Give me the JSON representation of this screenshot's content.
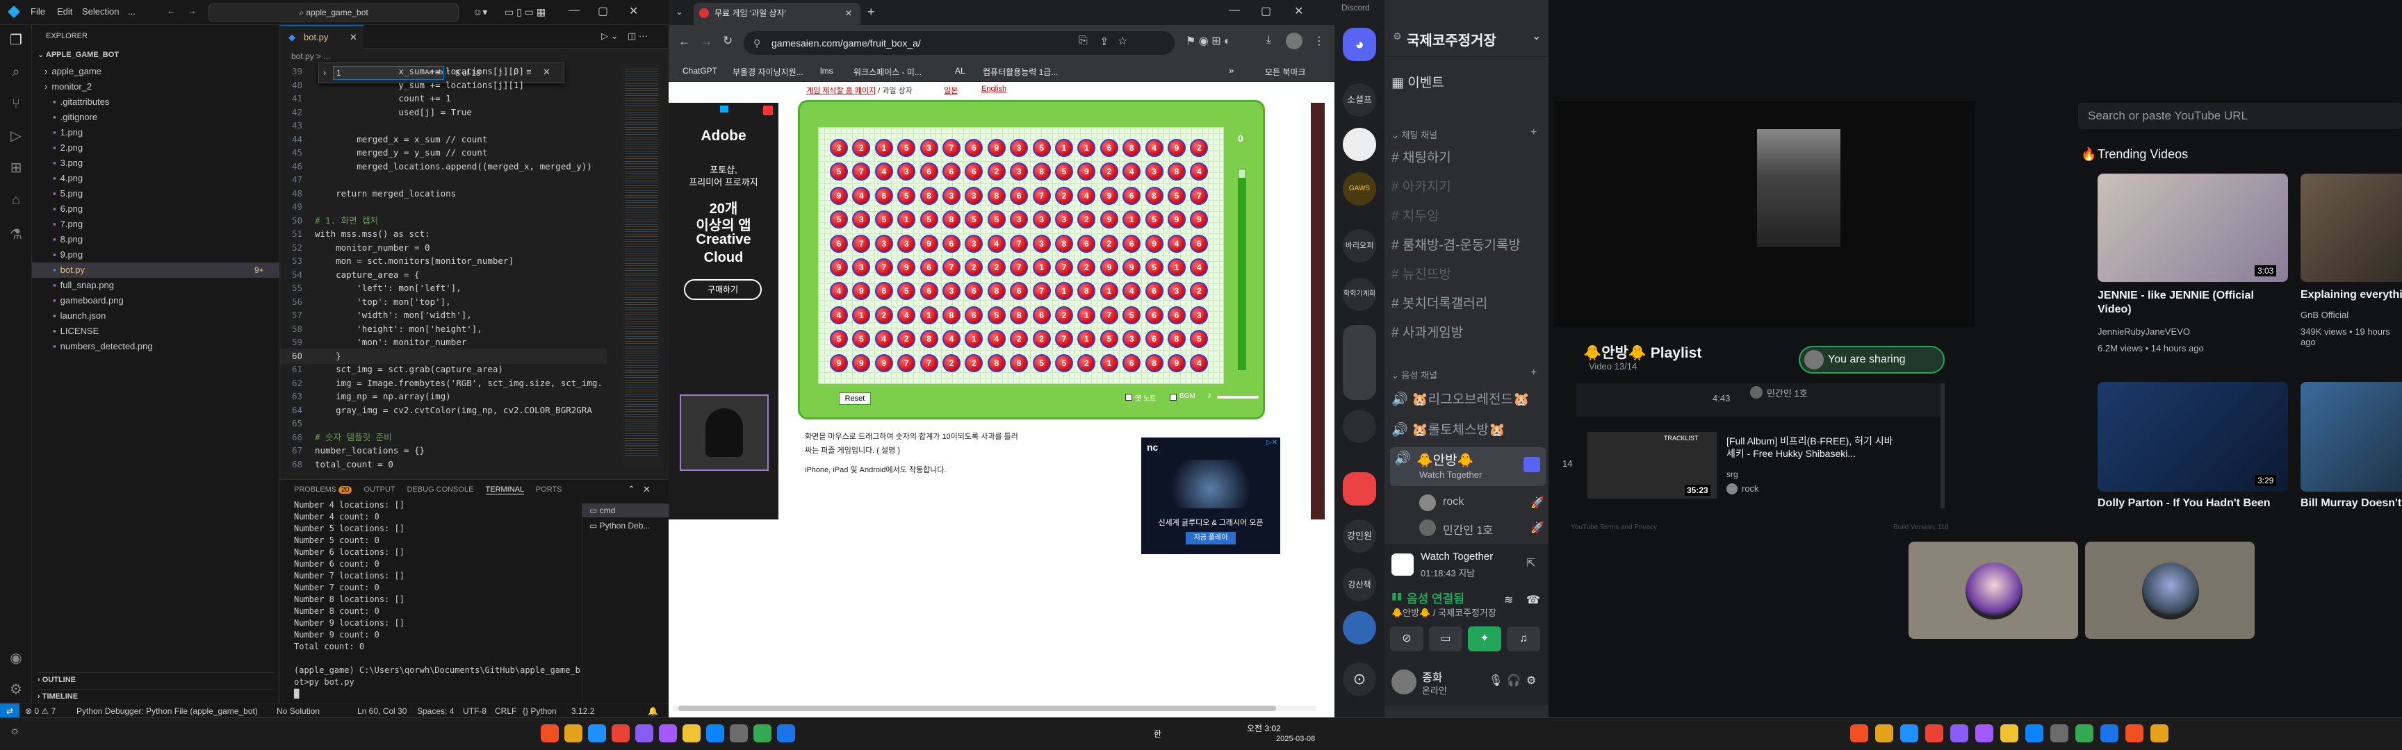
{
  "vscode": {
    "menu": [
      "File",
      "Edit",
      "Selection",
      "..."
    ],
    "search": "apple_game_bot",
    "explorer_title": "EXPLORER",
    "project": "APPLE_GAME_BOT",
    "files": [
      "apple_game",
      "monitor_2",
      ".gitattributes",
      ".gitignore",
      "1.png",
      "2.png",
      "3.png",
      "4.png",
      "5.png",
      "6.png",
      "7.png",
      "8.png",
      "9.png",
      "bot.py",
      "full_snap.png",
      "gameboard.png",
      "launch.json",
      "LICENSE",
      "numbers_detected.png"
    ],
    "active_file": "bot.py",
    "active_badge": "9+",
    "outline": "OUTLINE",
    "timeline": "TIMELINE",
    "tab": "bot.py",
    "breadcrumb": "bot.py > ...",
    "find_value": "1",
    "find_count": "8 of 18",
    "code_lines": [
      {
        "n": "39",
        "t": "                x_sum += locations[j][0]"
      },
      {
        "n": "40",
        "t": "                y_sum += locations[j][1]"
      },
      {
        "n": "41",
        "t": "                count += 1"
      },
      {
        "n": "42",
        "t": "                used[j] = True"
      },
      {
        "n": "43",
        "t": ""
      },
      {
        "n": "44",
        "t": "        merged_x = x_sum // count"
      },
      {
        "n": "45",
        "t": "        merged_y = y_sum // count"
      },
      {
        "n": "46",
        "t": "        merged_locations.append((merged_x, merged_y))"
      },
      {
        "n": "47",
        "t": ""
      },
      {
        "n": "48",
        "t": "    return merged_locations"
      },
      {
        "n": "49",
        "t": ""
      },
      {
        "n": "50",
        "t": "# 1. 화면 캡처"
      },
      {
        "n": "51",
        "t": "with mss.mss() as sct:"
      },
      {
        "n": "52",
        "t": "    monitor_number = 0"
      },
      {
        "n": "53",
        "t": "    mon = sct.monitors[monitor_number]"
      },
      {
        "n": "54",
        "t": "    capture_area = {"
      },
      {
        "n": "55",
        "t": "        'left': mon['left'],"
      },
      {
        "n": "56",
        "t": "        'top': mon['top'],"
      },
      {
        "n": "57",
        "t": "        'width': mon['width'],"
      },
      {
        "n": "58",
        "t": "        'height': mon['height'],"
      },
      {
        "n": "59",
        "t": "        'mon': monitor_number"
      },
      {
        "n": "60",
        "t": "    }"
      },
      {
        "n": "61",
        "t": "    sct_img = sct.grab(capture_area)"
      },
      {
        "n": "62",
        "t": "    img = Image.frombytes('RGB', sct_img.size, sct_img."
      },
      {
        "n": "63",
        "t": "    img_np = np.array(img)"
      },
      {
        "n": "64",
        "t": "    gray_img = cv2.cvtColor(img_np, cv2.COLOR_BGR2GRA"
      },
      {
        "n": "65",
        "t": ""
      },
      {
        "n": "66",
        "t": "# 숫자 템플릿 준비"
      },
      {
        "n": "67",
        "t": "number_locations = {}"
      },
      {
        "n": "68",
        "t": "total_count = 0"
      }
    ],
    "panel_tabs": [
      "PROBLEMS",
      "OUTPUT",
      "DEBUG CONSOLE",
      "TERMINAL",
      "PORTS"
    ],
    "problems_badge": "20",
    "terminal_lines": [
      "Number 4 locations: []",
      "Number 4 count: 0",
      "Number 5 locations: []",
      "Number 5 count: 0",
      "Number 6 locations: []",
      "Number 6 count: 0",
      "Number 7 locations: []",
      "Number 7 count: 0",
      "Number 8 locations: []",
      "Number 8 count: 0",
      "Number 9 locations: []",
      "Number 9 count: 0",
      "Total count: 0",
      "",
      "(apple_game) C:\\Users\\qorwh\\Documents\\GitHub\\apple_game_b",
      "ot>py bot.py",
      "█"
    ],
    "terminals": [
      "cmd",
      "Python Deb..."
    ],
    "status": {
      "left": "⊗ 0 ⚠ 7",
      "debugger": "Python Debugger: Python File (apple_game_bot)",
      "solution": "No Solution",
      "pos": "Ln 60, Col 30",
      "spaces": "Spaces: 4",
      "enc": "UTF-8",
      "eol": "CRLF",
      "lang": "{} Python",
      "ver": "3.12.2"
    }
  },
  "chrome": {
    "tab_title": "무료 게임 '과일 상자'",
    "new_tab": "+",
    "url": "gamesaien.com/game/fruit_box_a/",
    "bookmarks": [
      "ChatGPT",
      "부울경 자이닝지원...",
      "lms",
      "워크스페이스 - 미...",
      "AL",
      "컴퓨터활용능력 1급..."
    ],
    "all_bookmarks": "모든 북마크",
    "game_nav": [
      "게임 제삭할 홈 페이지",
      "/ 과일 상자",
      "일본",
      "English"
    ],
    "score": "0",
    "reset": "Reset",
    "light_label": "옛 노트",
    "bgm_label": "BGM",
    "desc1": "화면을 마우스로 드래그하여 숫자의 합계가 10이되도록 사과를 틀러",
    "desc2": "싸는 퍼즐 게임입니다. ( 설명 )",
    "desc3": "iPhone, iPad 및 Android에서도 작동합니다.",
    "ad": {
      "brand": "Adobe",
      "l1": "포토샵,",
      "l2": "프리미어 프로까지",
      "big1": "20개",
      "big2": "이상의 앱",
      "big3": "Creative",
      "big4": "Cloud",
      "cta": "구매하기"
    },
    "nc_ad": {
      "logo": "nc",
      "text": "신세계 글루디오 & 그래시어 오픈",
      "btn": "지금 플레이"
    },
    "grid": [
      [
        3,
        2,
        1,
        5,
        3,
        7,
        6,
        9,
        3,
        5,
        1,
        1,
        6,
        8,
        4,
        9,
        2
      ],
      [
        5,
        7,
        4,
        3,
        6,
        6,
        6,
        2,
        3,
        8,
        5,
        9,
        2,
        4,
        3,
        8,
        4
      ],
      [
        9,
        4,
        6,
        5,
        8,
        3,
        3,
        8,
        6,
        7,
        2,
        4,
        9,
        6,
        8,
        5,
        7
      ],
      [
        5,
        3,
        5,
        1,
        5,
        8,
        5,
        5,
        3,
        3,
        3,
        2,
        9,
        1,
        5,
        9,
        9
      ],
      [
        6,
        7,
        3,
        3,
        9,
        6,
        3,
        4,
        7,
        3,
        8,
        6,
        2,
        6,
        9,
        4,
        6
      ],
      [
        9,
        3,
        7,
        9,
        6,
        7,
        2,
        2,
        7,
        1,
        7,
        2,
        9,
        9,
        5,
        1,
        4
      ],
      [
        4,
        9,
        6,
        5,
        6,
        3,
        6,
        8,
        6,
        7,
        1,
        8,
        1,
        4,
        6,
        3,
        2
      ],
      [
        4,
        1,
        2,
        4,
        1,
        8,
        6,
        5,
        8,
        6,
        2,
        1,
        7,
        5,
        6,
        6,
        3
      ],
      [
        5,
        5,
        4,
        2,
        8,
        4,
        1,
        4,
        2,
        2,
        7,
        1,
        5,
        3,
        6,
        8,
        5
      ],
      [
        9,
        9,
        9,
        7,
        7,
        2,
        2,
        8,
        8,
        5,
        5,
        2,
        1,
        6,
        8,
        9,
        4
      ]
    ]
  },
  "discord": {
    "app": "Discord",
    "server": "국제코주정거장",
    "events": "이벤트",
    "text_cat": "채팅 채널",
    "text_channels": [
      "채팅하기",
      "아카지기",
      "치두잉",
      "룸채방-겸-운동기록방",
      "뉴진뜨방",
      "봇치더록갤러리",
      "사과게임방"
    ],
    "voice_cat": "음성 채널",
    "voice_channels": [
      "🐹리그오브레전드🐹",
      "🐹롤토체스방🐹",
      "🐥안방🐥"
    ],
    "watch_together": "Watch Together",
    "users": [
      "rock",
      "민간인 1호"
    ],
    "rail_labels": [
      "소셜프",
      "바리오피",
      "학학기계회",
      "강인원",
      "강산책"
    ],
    "activity_title": "Watch Together",
    "activity_time": "01:18:43 지남",
    "connected": "음성 연결됨",
    "connected_sub": "🐥안방🐥 / 국제코주정거장",
    "user_name": "종화",
    "user_status": "온라인",
    "yt_search": "Search or paste YouTube URL",
    "trending": "Trending Videos",
    "videos": [
      {
        "title": "JENNIE - like JENNIE (Official Video)",
        "channel": "JennieRubyJaneVEVO",
        "meta": "6.2M views • 14 hours ago",
        "dur": "3:03"
      },
      {
        "title": "Explaining everything.",
        "channel": "GnB Official",
        "meta": "349K views • 19 hours ago",
        "dur": ""
      },
      {
        "title": "Dolly Parton - If You Hadn't Been",
        "channel": "",
        "meta": "",
        "dur": "3:29"
      },
      {
        "title": "Bill Murray Doesn't Flinch W",
        "channel": "",
        "meta": "",
        "dur": ""
      }
    ],
    "playlist_title": "🐥안방🐥 Playlist",
    "playlist_sub": "Video 13/14",
    "sharing": "You are sharing",
    "pl_prev_dur": "4:43",
    "pl_prev_user": "민간인 1호",
    "pl_item": {
      "idx": "14",
      "title": "[Full Album] 비프리(B-FREE), 허기 시바세키 - Free Hukky Shibaseki...",
      "user_top": "srg",
      "user": "rock",
      "dur": "35:23",
      "thumb": "TRACKLIST"
    },
    "footer_terms": "YouTube Terms and Privacy",
    "footer_build": "Build Version: 118"
  },
  "taskbar": {
    "time": "오전 3:02",
    "date": "2025-03-08",
    "lang": "한"
  }
}
